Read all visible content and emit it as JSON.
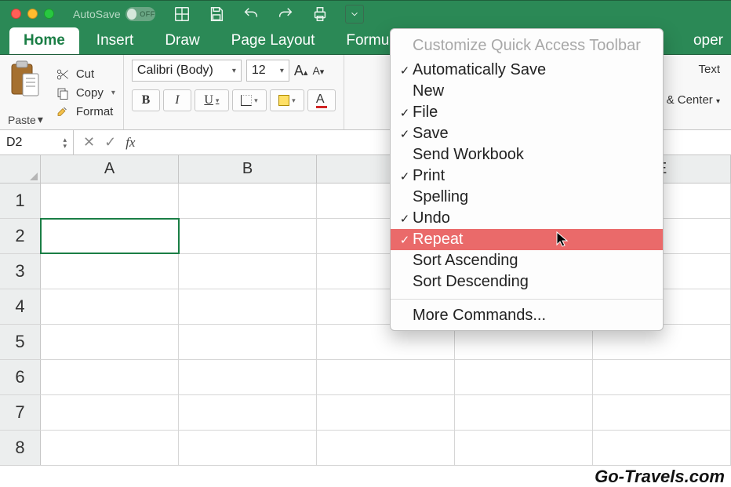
{
  "titlebar": {
    "autosave_label": "AutoSave",
    "autosave_state": "OFF"
  },
  "tabs": [
    "Home",
    "Insert",
    "Draw",
    "Page Layout",
    "Formula",
    "oper"
  ],
  "active_tab": "Home",
  "ribbon": {
    "paste_label": "Paste",
    "cut_label": "Cut",
    "copy_label": "Copy",
    "format_label": "Format",
    "font_name": "Calibri (Body)",
    "font_size": "12",
    "wrap_text": "Text",
    "merge_center": "e & Center"
  },
  "formula_bar": {
    "cell_ref": "D2",
    "formula": ""
  },
  "grid": {
    "columns": [
      "A",
      "B",
      "",
      "",
      "E"
    ],
    "rows": [
      "1",
      "2",
      "3",
      "4",
      "5",
      "6",
      "7",
      "8"
    ],
    "active_cell": {
      "row": 2,
      "col": 1
    }
  },
  "menu": {
    "header": "Customize Quick Access Toolbar",
    "items": [
      {
        "label": "Automatically Save",
        "checked": true
      },
      {
        "label": "New",
        "checked": false
      },
      {
        "label": "File",
        "checked": true
      },
      {
        "label": "Save",
        "checked": true
      },
      {
        "label": "Send Workbook",
        "checked": false
      },
      {
        "label": "Print",
        "checked": true
      },
      {
        "label": "Spelling",
        "checked": false
      },
      {
        "label": "Undo",
        "checked": true
      },
      {
        "label": "Repeat",
        "checked": true,
        "highlighted": true
      },
      {
        "label": "Sort Ascending",
        "checked": false
      },
      {
        "label": "Sort Descending",
        "checked": false
      }
    ],
    "more": "More Commands..."
  },
  "watermark": "Go-Travels.com"
}
